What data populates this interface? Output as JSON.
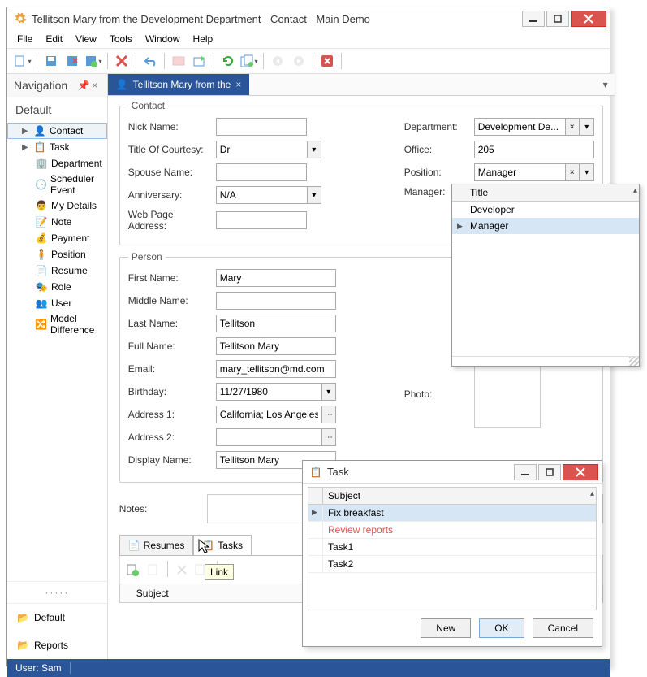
{
  "window": {
    "title": "Tellitson Mary from the Development Department - Contact - Main Demo"
  },
  "menubar": [
    "File",
    "Edit",
    "View",
    "Tools",
    "Window",
    "Help"
  ],
  "nav": {
    "header": "Navigation",
    "section": "Default",
    "items": [
      {
        "label": "Contact"
      },
      {
        "label": "Task"
      },
      {
        "label": "Department"
      },
      {
        "label": "Scheduler Event"
      },
      {
        "label": "My Details"
      },
      {
        "label": "Note"
      },
      {
        "label": "Payment"
      },
      {
        "label": "Position"
      },
      {
        "label": "Resume"
      },
      {
        "label": "Role"
      },
      {
        "label": "User"
      },
      {
        "label": "Model Difference"
      }
    ],
    "folders": [
      {
        "label": "Default"
      },
      {
        "label": "Reports"
      }
    ]
  },
  "tab": {
    "label": "Tellitson Mary from the"
  },
  "contact": {
    "legend": "Contact",
    "nick_label": "Nick Name:",
    "nick_value": "",
    "title_label": "Title Of Courtesy:",
    "title_value": "Dr",
    "spouse_label": "Spouse Name:",
    "spouse_value": "",
    "ann_label": "Anniversary:",
    "ann_value": "N/A",
    "web_label": "Web Page Address:",
    "web_value": "",
    "dept_label": "Department:",
    "dept_value": "Development De...",
    "office_label": "Office:",
    "office_value": "205",
    "pos_label": "Position:",
    "pos_value": "Manager",
    "mgr_label": "Manager:"
  },
  "person": {
    "legend": "Person",
    "first_label": "First Name:",
    "first_value": "Mary",
    "middle_label": "Middle Name:",
    "middle_value": "",
    "last_label": "Last Name:",
    "last_value": "Tellitson",
    "full_label": "Full Name:",
    "full_value": "Tellitson Mary",
    "email_label": "Email:",
    "email_value": "mary_tellitson@md.com",
    "bday_label": "Birthday:",
    "bday_value": "11/27/1980",
    "addr1_label": "Address 1:",
    "addr1_value": "California; Los Angeles",
    "addr2_label": "Address 2:",
    "addr2_value": "",
    "disp_label": "Display Name:",
    "disp_value": "Tellitson Mary",
    "photo_label": "Photo:"
  },
  "notes_label": "Notes:",
  "subtabs": {
    "resumes": "Resumes",
    "tasks": "Tasks"
  },
  "grid_subject": "Subject",
  "tooltip": "Link",
  "positionDropdown": {
    "header": "Title",
    "items": [
      "Developer",
      "Manager"
    ],
    "selected": 1
  },
  "taskWindow": {
    "title": "Task",
    "subject": "Subject",
    "rows": [
      {
        "text": "Fix breakfast",
        "sel": true
      },
      {
        "text": "Review reports",
        "red": true
      },
      {
        "text": "Task1"
      },
      {
        "text": "Task2"
      }
    ],
    "buttons": {
      "new": "New",
      "ok": "OK",
      "cancel": "Cancel"
    }
  },
  "status": {
    "user": "User: Sam"
  }
}
